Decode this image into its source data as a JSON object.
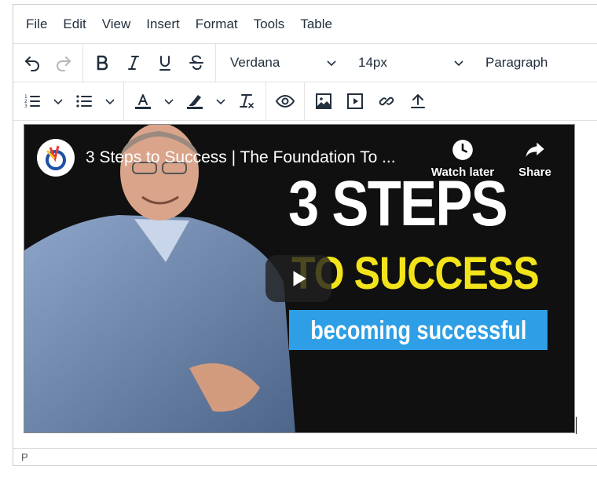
{
  "menubar": {
    "items": [
      "File",
      "Edit",
      "View",
      "Insert",
      "Format",
      "Tools",
      "Table"
    ]
  },
  "toolbar": {
    "font_family": "Verdana",
    "font_size": "14px",
    "block_format": "Paragraph",
    "icons_row1": [
      "undo-icon",
      "redo-icon",
      "bold-icon",
      "italic-icon",
      "underline-icon",
      "strikethrough-icon"
    ],
    "icons_row2": [
      "numbered-list-icon",
      "bullet-list-icon",
      "text-color-icon",
      "highlight-icon",
      "clear-formatting-icon",
      "preview-icon",
      "image-icon",
      "media-icon",
      "link-icon",
      "upload-icon"
    ]
  },
  "video": {
    "title": "3 Steps to Success | The Foundation To ...",
    "watch_later_label": "Watch later",
    "share_label": "Share",
    "thumbnail_heading": "3 STEPS",
    "thumbnail_subheading": "TO SUCCESS",
    "thumbnail_banner": "becoming successful",
    "colors": {
      "subheading": "#f2e31a",
      "banner": "#2e9fe6"
    }
  },
  "statusbar": {
    "path": "P"
  }
}
